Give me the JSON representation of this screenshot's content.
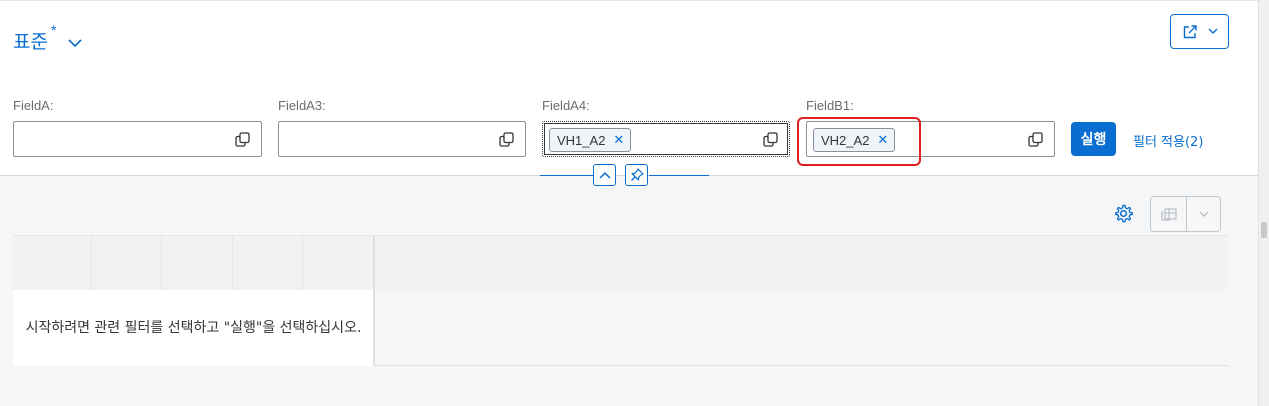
{
  "variant": {
    "title": "표준",
    "modified_marker": "*"
  },
  "filter_bar": {
    "fields": [
      {
        "label": "FieldA:",
        "tokens": []
      },
      {
        "label": "FieldA3:",
        "tokens": []
      },
      {
        "label": "FieldA4:",
        "tokens": [
          "VH1_A2"
        ]
      },
      {
        "label": "FieldB1:",
        "tokens": [
          "VH2_A2"
        ]
      }
    ],
    "go_label": "실행",
    "adapt_filters_label": "필터 적용(2)"
  },
  "table": {
    "no_data_text": "시작하려면 관련 필터를 선택하고 \"실행\"을 선택하십시오."
  },
  "colors": {
    "accent": "#0a6ed1",
    "highlight": "#e02020"
  },
  "icons": [
    "chevron-down-icon",
    "share-icon",
    "value-help-icon",
    "collapse-icon",
    "pin-icon",
    "settings-icon",
    "export-icon"
  ]
}
